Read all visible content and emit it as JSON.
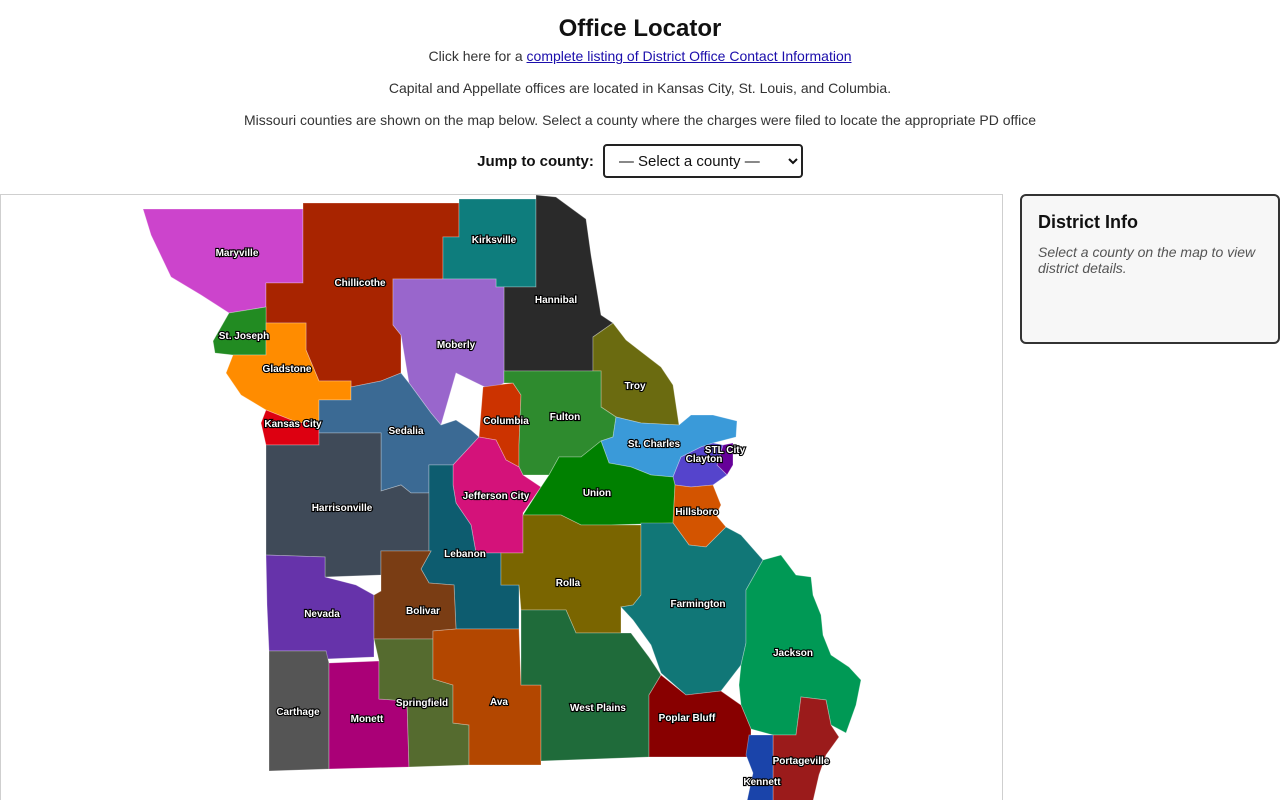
{
  "page": {
    "title": "Office Locator",
    "listing_prefix": "Click here for a ",
    "listing_link": "complete listing of District Office Contact Information",
    "capital_note": "Capital and Appellate offices are located in Kansas City, St. Louis, and Columbia.",
    "map_note": "Missouri counties are shown on the map below. Select a county where the charges were filed to locate the appropriate PD office"
  },
  "jump": {
    "label": "Jump to county:",
    "selected": "— Select a county —"
  },
  "info": {
    "heading": "District Info",
    "text": "Select a county on the map to view district details."
  },
  "districts": [
    {
      "name": "Maryville",
      "color": "#cc44cc"
    },
    {
      "name": "Chillicothe",
      "color": "#a82400"
    },
    {
      "name": "Kirksville",
      "color": "#0e7d7d"
    },
    {
      "name": "Hannibal",
      "color": "#2a2a2a"
    },
    {
      "name": "St. Joseph",
      "color": "#228b22"
    },
    {
      "name": "Moberly",
      "color": "#9966cc"
    },
    {
      "name": "Gladstone",
      "color": "#ff8c00"
    },
    {
      "name": "Troy",
      "color": "#6b6b10"
    },
    {
      "name": "Kansas City",
      "color": "#dd0011"
    },
    {
      "name": "Sedalia",
      "color": "#3b6a94"
    },
    {
      "name": "Columbia",
      "color": "#cc3300"
    },
    {
      "name": "Fulton",
      "color": "#2e8b2e"
    },
    {
      "name": "St. Charles",
      "color": "#3a9ad9"
    },
    {
      "name": "STL City",
      "color": "#660099"
    },
    {
      "name": "Clayton",
      "color": "#5544cc"
    },
    {
      "name": "Jefferson City",
      "color": "#d4127a"
    },
    {
      "name": "Union",
      "color": "#008000"
    },
    {
      "name": "Harrisonville",
      "color": "#3f4a58"
    },
    {
      "name": "Hillsboro",
      "color": "#d35400"
    },
    {
      "name": "Lebanon",
      "color": "#0d5c6f"
    },
    {
      "name": "Rolla",
      "color": "#7a6500"
    },
    {
      "name": "Nevada",
      "color": "#6633aa"
    },
    {
      "name": "Bolivar",
      "color": "#7a3d14"
    },
    {
      "name": "Farmington",
      "color": "#117777"
    },
    {
      "name": "Jackson",
      "color": "#009955"
    },
    {
      "name": "Carthage",
      "color": "#555555"
    },
    {
      "name": "Springfield",
      "color": "#aa0077"
    },
    {
      "name": "Ava",
      "color": "#556b2f"
    },
    {
      "name": "West Plains",
      "color": "#b34700"
    },
    {
      "name": "Poplar Bluff",
      "color": "#1f6b3a"
    },
    {
      "name": "Monett",
      "color": "#880000"
    },
    {
      "name": "Portageville",
      "color": "#9b1b1b"
    },
    {
      "name": "Kennett",
      "color": "#1a44aa"
    }
  ]
}
